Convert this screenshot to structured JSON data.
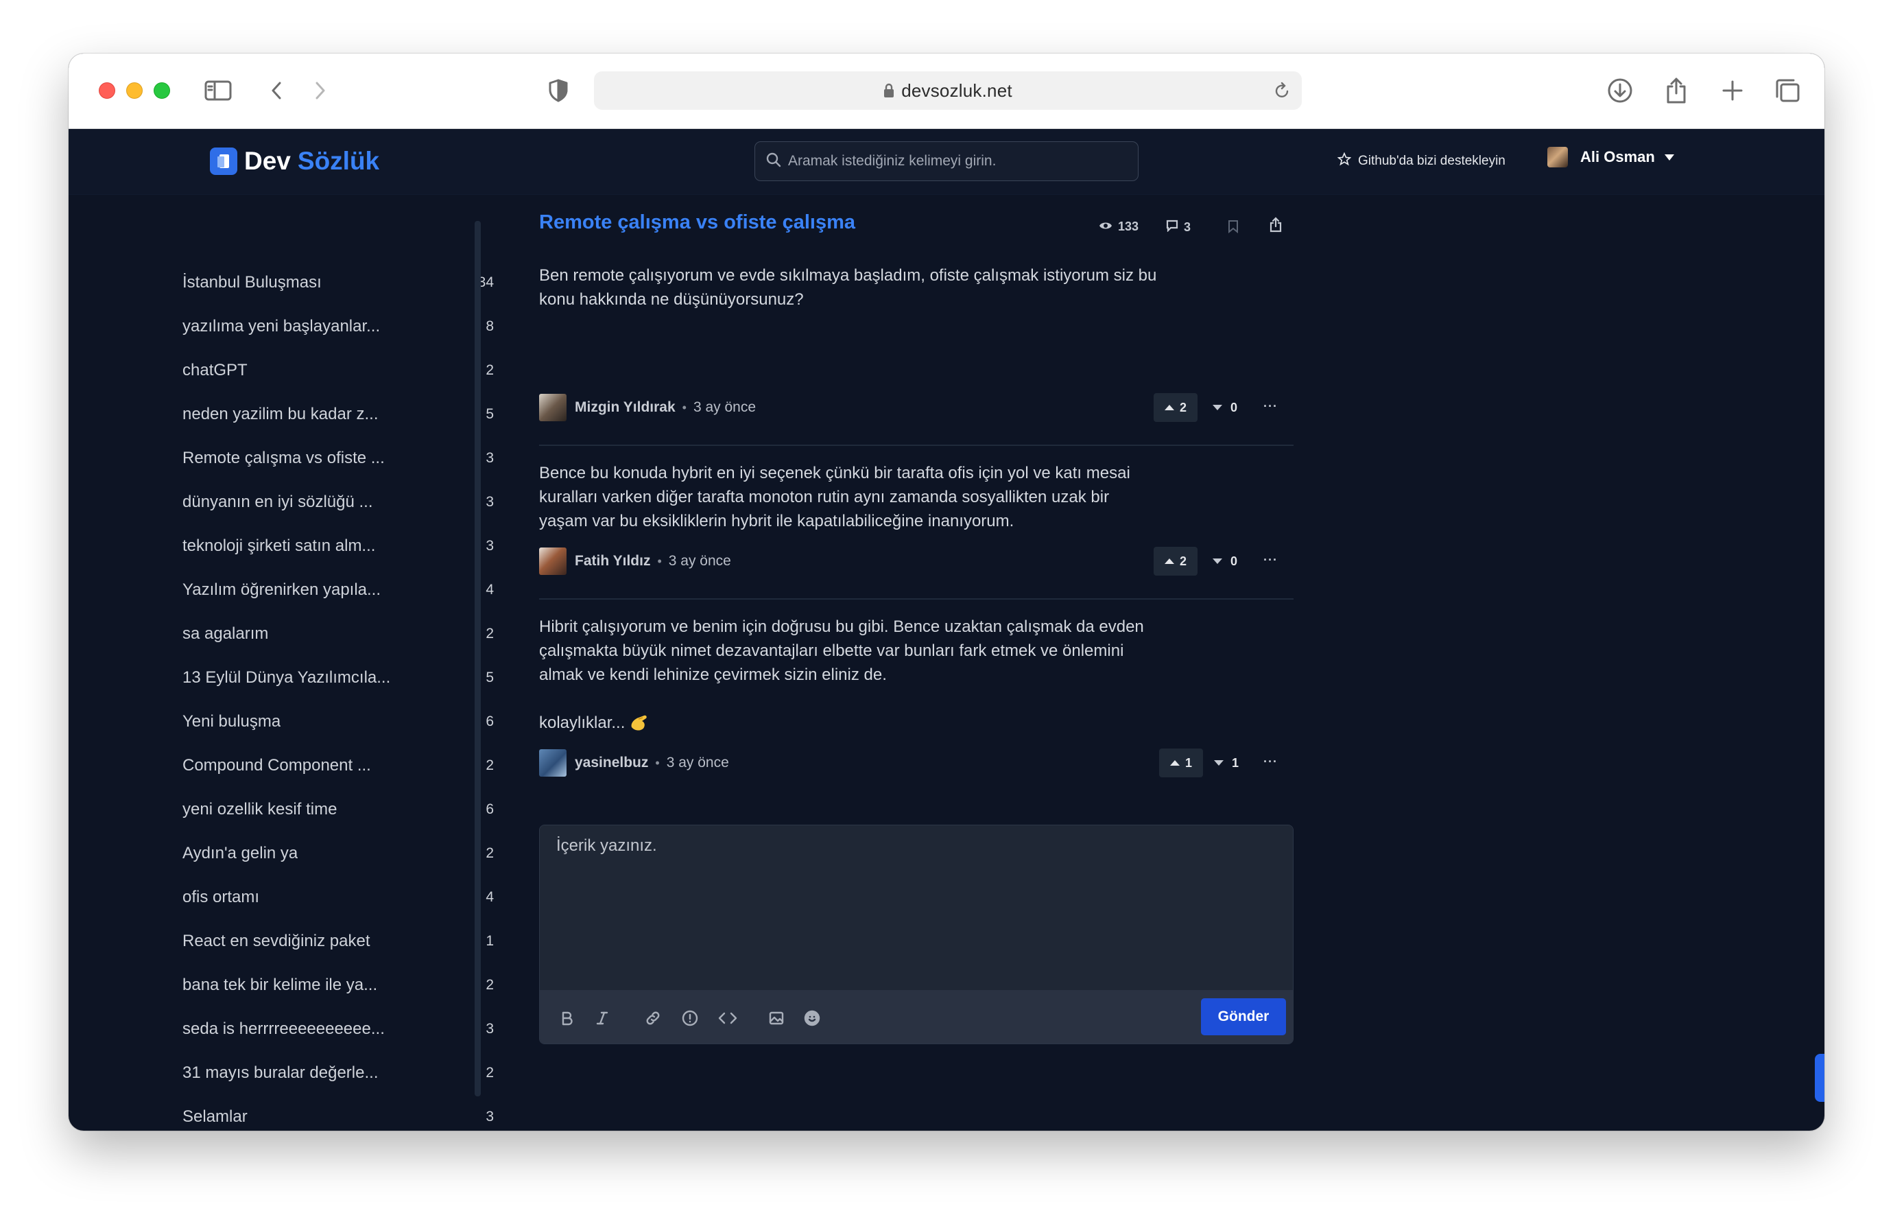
{
  "browser": {
    "url": "devsozluk.net"
  },
  "header": {
    "logo_dev": "Dev",
    "logo_sozluk": "Sözlük",
    "search_placeholder": "Aramak istediğiniz kelimeyi girin.",
    "github_label": "Github'da bizi destekleyin",
    "user_name": "Ali Osman"
  },
  "sidebar": {
    "items": [
      {
        "title": "İstanbul Buluşması",
        "count": "34"
      },
      {
        "title": "yazılıma yeni başlayanlar...",
        "count": "8"
      },
      {
        "title": "chatGPT",
        "count": "2"
      },
      {
        "title": "neden yazilim bu kadar z...",
        "count": "5"
      },
      {
        "title": "Remote çalışma vs ofiste ...",
        "count": "3"
      },
      {
        "title": "dünyanın en iyi sözlüğü ...",
        "count": "3"
      },
      {
        "title": "teknoloji şirketi satın alm...",
        "count": "3"
      },
      {
        "title": "Yazılım öğrenirken yapıla...",
        "count": "4"
      },
      {
        "title": "sa agalarım",
        "count": "2"
      },
      {
        "title": "13 Eylül Dünya Yazılımcıla...",
        "count": "5"
      },
      {
        "title": "Yeni buluşma",
        "count": "6"
      },
      {
        "title": "Compound Component ...",
        "count": "2"
      },
      {
        "title": "yeni ozellik kesif time",
        "count": "6"
      },
      {
        "title": "Aydın'a gelin ya",
        "count": "2"
      },
      {
        "title": "ofis ortamı",
        "count": "4"
      },
      {
        "title": "React en sevdiğiniz paket",
        "count": "1"
      },
      {
        "title": "bana tek bir kelime ile ya...",
        "count": "2"
      },
      {
        "title": "seda is herrrreeeeeeeeee...",
        "count": "3"
      },
      {
        "title": "31 mayıs buralar değerle...",
        "count": "2"
      },
      {
        "title": "Selamlar",
        "count": "3"
      }
    ]
  },
  "topic": {
    "title": "Remote çalışma vs ofiste çalışma",
    "views": "133",
    "comments": "3"
  },
  "entries": [
    {
      "lines": [
        "Ben remote çalışıyorum ve evde sıkılmaya başladım, ofiste çalışmak istiyorum siz bu",
        "konu hakkında ne düşünüyorsunuz?"
      ],
      "author": "Mizgin Yıldırak",
      "date": "3 ay önce",
      "up": "2",
      "down": "0",
      "more": "···"
    },
    {
      "lines": [
        "Bence bu konuda hybrit en iyi seçenek çünkü bir tarafta ofis için yol ve katı mesai",
        "kuralları varken diğer tarafta monoton rutin aynı zamanda sosyallikten uzak bir",
        "yaşam var bu eksikliklerin hybrit ile kapatılabiliceğine inanıyorum."
      ],
      "author": "Fatih Yıldız",
      "date": "3 ay önce",
      "up": "2",
      "down": "0",
      "more": "···"
    },
    {
      "lines": [
        "Hibrit çalışıyorum ve benim için doğrusu bu gibi. Bence uzaktan çalışmak da evden",
        "çalışmakta büyük nimet dezavantajları elbette var bunları fark etmek ve önlemini",
        "almak ve kendi lehinize çevirmek sizin eliniz de."
      ],
      "extra": "kolaylıklar...",
      "author": "yasinelbuz",
      "date": "3 ay önce",
      "up": "1",
      "down": "1",
      "more": "···"
    }
  ],
  "editor": {
    "placeholder": "İçerik yazınız.",
    "send_label": "Gönder"
  },
  "colors": {
    "background": "#0d1424",
    "accent": "#3a82f6",
    "button": "#1d4ed8"
  }
}
